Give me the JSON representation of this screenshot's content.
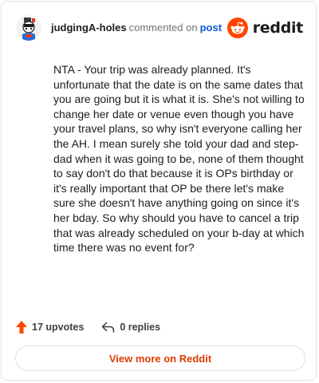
{
  "comment": {
    "username": "judgingA-holes",
    "action_text": "commented on",
    "post_link": "post",
    "body": "NTA - Your trip was already planned. It's unfortunate that the date is on the same dates that you are going but it is what it is. She's not willing to change her date or venue even though you have your travel plans, so why isn't everyone calling her the AH. I mean surely she told your dad and step-dad when it was going to be, none of them thought to say don't do that because it is OPs birthday or it's really important that OP be there let's make sure she doesn't have anything going on since it's her bday. So why should you have to cancel a trip that was already scheduled on your b-day at which time there was no event for?"
  },
  "brand": {
    "name": "reddit",
    "icon": "reddit-logo-icon",
    "color": "#ff4500"
  },
  "actions": {
    "upvotes": "17 upvotes",
    "replies": "0 replies",
    "upvote_icon": "upvote-arrow-icon",
    "reply_icon": "reply-arrow-icon"
  },
  "footer": {
    "view_more": "View more on Reddit"
  },
  "colors": {
    "link": "#0a5ad6",
    "accent": "#e03c00",
    "upvote": "#ff4500",
    "border": "#dfe1e3"
  }
}
